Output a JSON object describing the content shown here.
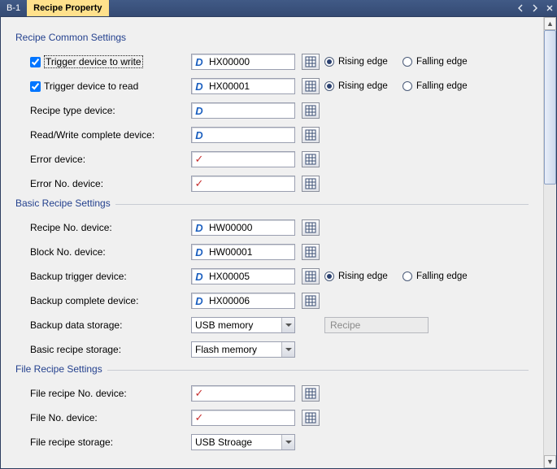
{
  "titlebar": {
    "tabB1": "B-1",
    "tabActive": "Recipe Property"
  },
  "sections": {
    "common": "Recipe Common Settings",
    "basic": "Basic Recipe Settings",
    "file": "File Recipe Settings"
  },
  "labels": {
    "triggerWrite": "Trigger device to write",
    "triggerRead": "Trigger device to read",
    "recipeType": "Recipe type device:",
    "rwComplete": "Read/Write complete device:",
    "errorDevice": "Error device:",
    "errorNoDevice": "Error No. device:",
    "recipeNoDevice": "Recipe No. device:",
    "blockNoDevice": "Block No. device:",
    "backupTrigger": "Backup trigger device:",
    "backupComplete": "Backup complete device:",
    "backupStorage": "Backup data storage:",
    "basicStorage": "Basic recipe storage:",
    "fileRecipeNoDevice": "File recipe No. device:",
    "fileNoDevice": "File No. device:",
    "fileRecipeStorage": "File recipe storage:"
  },
  "values": {
    "triggerWrite": "HX00000",
    "triggerRead": "HX00001",
    "recipeType": "",
    "rwComplete": "",
    "errorDevice": "",
    "errorNoDevice": "",
    "recipeNoDevice": "HW00000",
    "blockNoDevice": "HW00001",
    "backupTrigger": "HX00005",
    "backupComplete": "HX00006",
    "backupStorage": "USB memory",
    "backupStorageBox": "Recipe",
    "basicStorage": "Flash memory",
    "fileRecipeNoDevice": "",
    "fileNoDevice": "",
    "fileRecipeStorage": "USB Stroage"
  },
  "radio": {
    "rising": "Rising edge",
    "falling": "Falling edge"
  }
}
